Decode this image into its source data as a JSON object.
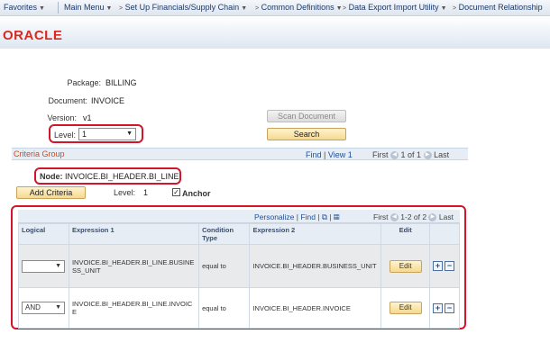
{
  "nav": {
    "favorites": "Favorites",
    "main_menu": "Main Menu",
    "crumb1": "Set Up Financials/Supply Chain",
    "crumb2": "Common Definitions",
    "crumb3": "Data Export Import Utility",
    "crumb4": "Document Relationship"
  },
  "logo": "ORACLE",
  "form": {
    "package_label": "Package:",
    "package_value": "BILLING",
    "document_label": "Document:",
    "document_value": "INVOICE",
    "version_label": "Version:",
    "version_value": "v1",
    "level_label": "Level:",
    "level_value": "1",
    "scan_document": "Scan Document",
    "search": "Search"
  },
  "criteria_group": {
    "title": "Criteria Group",
    "find": "Find",
    "view1": "View 1",
    "first": "First",
    "range": "1 of 1",
    "last": "Last",
    "node_label": "Node:",
    "node_value": "INVOICE.BI_HEADER.BI_LINE",
    "add_criteria": "Add Criteria",
    "level_label": "Level:",
    "level_value": "1",
    "anchor_label": "Anchor",
    "anchor_checked": "✓"
  },
  "grid": {
    "personalize": "Personalize",
    "find": "Find",
    "first": "First",
    "range": "1-2 of 2",
    "last": "Last",
    "columns": {
      "logical": "Logical",
      "expr1": "Expression 1",
      "condition": "Condition Type",
      "expr2": "Expression 2",
      "edit": "Edit"
    },
    "rows": [
      {
        "logical": "",
        "expr1": "INVOICE.BI_HEADER.BI_LINE.BUSINESS_UNIT",
        "condition": "equal to",
        "expr2": "INVOICE.BI_HEADER.BUSINESS_UNIT",
        "edit": "Edit",
        "add": "+",
        "remove": "−"
      },
      {
        "logical": "AND",
        "expr1": "INVOICE.BI_HEADER.BI_LINE.INVOICE",
        "condition": "equal to",
        "expr2": "INVOICE.BI_HEADER.INVOICE",
        "edit": "Edit",
        "add": "+",
        "remove": "−"
      }
    ]
  },
  "colors": {
    "highlight_outline": "#d4142a",
    "oracle_red": "#d62a20",
    "link_blue": "#1f4f9c"
  }
}
